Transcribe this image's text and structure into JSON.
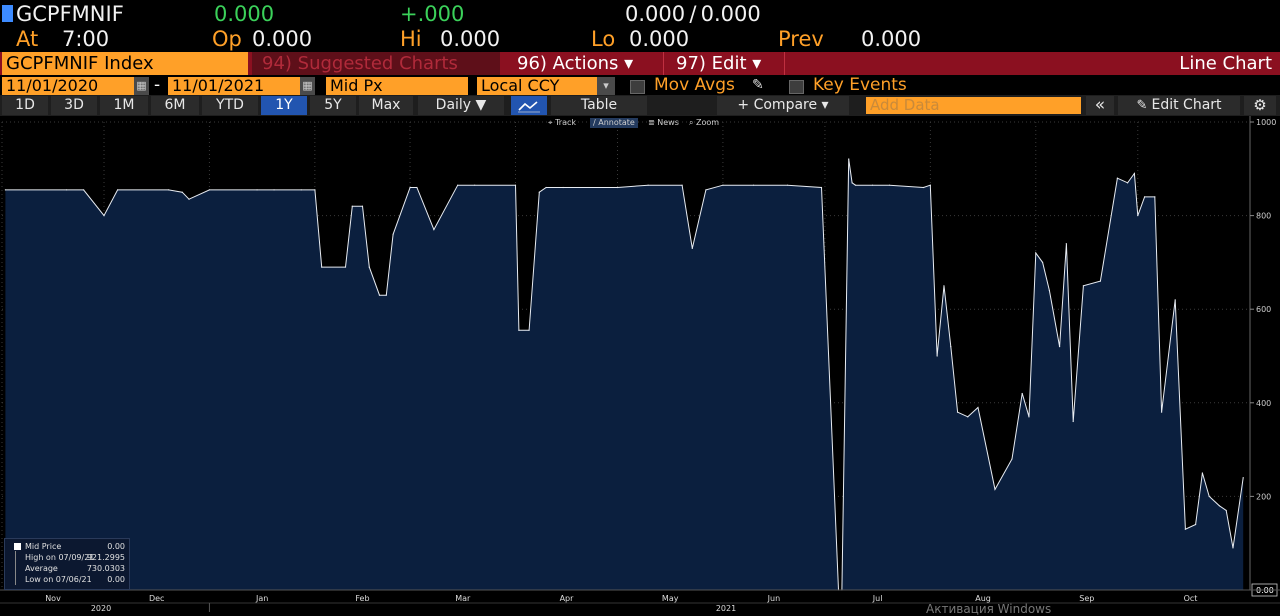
{
  "quote": {
    "ticker": "GCPFMNIF",
    "last": "0.000",
    "change": "+.000",
    "bid_ask": "0.000 / 0.000",
    "at_label": "At",
    "at_time": "7:00",
    "op_label": "Op",
    "op_value": "0.000",
    "hi_label": "Hi",
    "hi_value": "0.000",
    "lo_label": "Lo",
    "lo_value": "0.000",
    "prev_label": "Prev",
    "prev_value": "0.000"
  },
  "menu": {
    "security": "GCPFMNIF Index",
    "suggested": "94) Suggested Charts",
    "actions": "96) Actions ▾",
    "edit": "97) Edit ▾",
    "chart_type": "Line Chart"
  },
  "params": {
    "start_date": "11/01/2020",
    "dash": "-",
    "end_date": "11/01/2021",
    "field": "Mid Px",
    "currency": "Local CCY",
    "mov_avgs": "Mov Avgs",
    "key_events": "Key Events"
  },
  "toolbar": {
    "ranges": [
      "1D",
      "3D",
      "1M",
      "6M",
      "YTD",
      "1Y",
      "5Y",
      "Max"
    ],
    "active_range": "1Y",
    "frequency": "Daily ▼",
    "table": "Table",
    "compare": "+ Compare ▾",
    "add_data_placeholder": "Add Data",
    "collapse": "«",
    "edit_chart": "Edit Chart",
    "settings_icon": "gear-icon"
  },
  "chart_tools": [
    "Track",
    "Annotate",
    "News",
    "Zoom"
  ],
  "legend": {
    "mid_price_label": "Mid Price",
    "mid_price_value": "0.00",
    "high_label": "High on 07/09/21",
    "high_value": "921.2995",
    "avg_label": "Average",
    "avg_value": "730.0303",
    "low_label": "Low on 07/06/21",
    "low_value": "0.00"
  },
  "watermark": "Активация Windows",
  "colors": {
    "accent_orange": "#ffa028",
    "series_fill": "#0b1f3e",
    "series_line": "#e8ecf2",
    "menu_bar": "#8b1020",
    "positive": "#3bd15a"
  },
  "chart_data": {
    "type": "area",
    "title": "",
    "xlabel": "",
    "ylabel": "",
    "ylim": [
      0,
      1000
    ],
    "yticks": [
      0,
      200,
      400,
      600,
      800,
      1000
    ],
    "last_value_label": "0.00",
    "xticks": [
      "Nov",
      "Dec",
      "Jan",
      "Feb",
      "Mar",
      "Apr",
      "May",
      "Jun",
      "Jul",
      "Aug",
      "Sep",
      "Oct"
    ],
    "year_labels": [
      "2020",
      "2021"
    ],
    "x": [
      "2020-11-02",
      "2020-11-20",
      "2020-11-25",
      "2020-12-01",
      "2020-12-05",
      "2020-12-20",
      "2020-12-24",
      "2020-12-26",
      "2021-01-01",
      "2021-01-15",
      "2021-01-20",
      "2021-01-28",
      "2021-02-01",
      "2021-02-03",
      "2021-02-10",
      "2021-02-12",
      "2021-02-15",
      "2021-02-17",
      "2021-02-20",
      "2021-02-22",
      "2021-02-24",
      "2021-03-01",
      "2021-03-03",
      "2021-03-08",
      "2021-03-15",
      "2021-03-20",
      "2021-04-01",
      "2021-04-02",
      "2021-04-05",
      "2021-04-08",
      "2021-04-10",
      "2021-04-15",
      "2021-05-01",
      "2021-05-10",
      "2021-05-20",
      "2021-05-23",
      "2021-05-27",
      "2021-06-01",
      "2021-06-10",
      "2021-06-20",
      "2021-06-30",
      "2021-07-05",
      "2021-07-06",
      "2021-07-08",
      "2021-07-09",
      "2021-07-10",
      "2021-07-15",
      "2021-07-20",
      "2021-07-30",
      "2021-08-01",
      "2021-08-03",
      "2021-08-05",
      "2021-08-07",
      "2021-08-09",
      "2021-08-12",
      "2021-08-15",
      "2021-08-20",
      "2021-08-25",
      "2021-08-28",
      "2021-08-30",
      "2021-09-01",
      "2021-09-03",
      "2021-09-05",
      "2021-09-08",
      "2021-09-10",
      "2021-09-12",
      "2021-09-15",
      "2021-09-20",
      "2021-09-25",
      "2021-09-28",
      "2021-09-30",
      "2021-10-01",
      "2021-10-03",
      "2021-10-06",
      "2021-10-08",
      "2021-10-12",
      "2021-10-15",
      "2021-10-18",
      "2021-10-20",
      "2021-10-22",
      "2021-10-25",
      "2021-10-27",
      "2021-10-29",
      "2021-11-01"
    ],
    "series": [
      {
        "values": [
          855,
          855,
          855,
          800,
          855,
          855,
          850,
          835,
          855,
          855,
          855,
          855,
          855,
          690,
          690,
          820,
          820,
          690,
          630,
          630,
          760,
          860,
          860,
          770,
          865,
          865,
          865,
          555,
          555,
          850,
          860,
          860,
          860,
          865,
          865,
          730,
          855,
          865,
          865,
          865,
          860,
          0,
          0,
          921,
          870,
          865,
          865,
          865,
          860,
          865,
          500,
          650,
          520,
          380,
          370,
          390,
          215,
          280,
          420,
          370,
          720,
          700,
          640,
          520,
          740,
          360,
          650,
          660,
          880,
          870,
          890,
          800,
          840,
          840,
          380,
          620,
          130,
          140,
          250,
          200,
          180,
          170,
          90,
          240,
          0
        ]
      }
    ]
  }
}
